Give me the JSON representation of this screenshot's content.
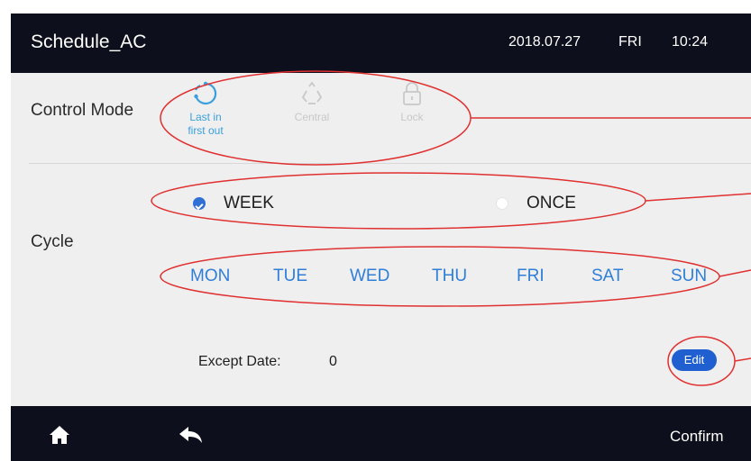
{
  "header": {
    "title": "Schedule_AC",
    "date": "2018.07.27",
    "day": "FRI",
    "time": "10:24"
  },
  "control_mode": {
    "label": "Control Mode",
    "modes": [
      {
        "label_line1": "Last in",
        "label_line2": "first out",
        "icon": "refresh-circle-icon",
        "state": "selected"
      },
      {
        "label_line1": "Central",
        "label_line2": "",
        "icon": "triangle-arrows-icon",
        "state": "disabled"
      },
      {
        "label_line1": "Lock",
        "label_line2": "",
        "icon": "lock-icon",
        "state": "disabled"
      }
    ]
  },
  "cycle": {
    "label": "Cycle",
    "options": [
      {
        "label": "WEEK",
        "selected": true
      },
      {
        "label": "ONCE",
        "selected": false
      }
    ],
    "days": [
      "MON",
      "TUE",
      "WED",
      "THU",
      "FRI",
      "SAT",
      "SUN"
    ]
  },
  "except": {
    "label": "Except Date:",
    "value": "0",
    "edit_label": "Edit"
  },
  "footer": {
    "home_icon": "home-icon",
    "back_icon": "back-arrow-icon",
    "confirm_label": "Confirm"
  },
  "colors": {
    "header_bg": "#0d0f1c",
    "accent_blue": "#2f7ed8",
    "annotation_red": "#e03030"
  }
}
